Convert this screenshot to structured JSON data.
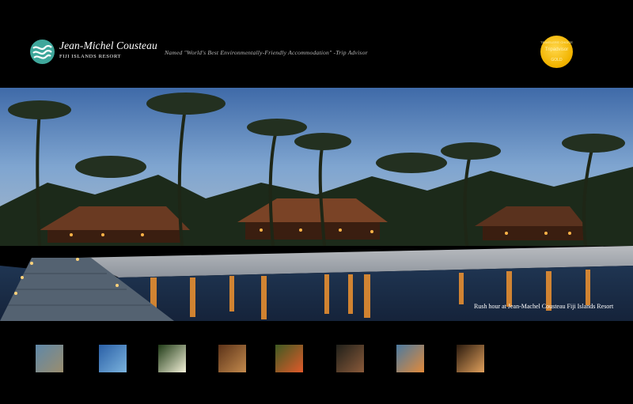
{
  "header": {
    "logo": {
      "name": "Jean-Michel Cousteau",
      "subtitle": "FIJI ISLANDS RESORT"
    },
    "tagline": "Named \"World's Best Environmentally-Friendly Accommodation\" -Trip Advisor",
    "award": {
      "top": "TRAVELERS' CHOICE",
      "main": "Tripadvisor",
      "bottom": "GOLD"
    }
  },
  "hero": {
    "caption": "Rush hour at Jean-Machel Cousteau Fiji Islands Resort"
  },
  "thumbnails": [
    {
      "name": "aerial-reef",
      "colors": [
        "#5f88a8",
        "#9a8d6e"
      ]
    },
    {
      "name": "dolphin",
      "colors": [
        "#2a5fa6",
        "#7bb3dd"
      ]
    },
    {
      "name": "frangipani-flowers",
      "colors": [
        "#1f3a16",
        "#f3f1d8"
      ]
    },
    {
      "name": "bure-interior",
      "colors": [
        "#5b3218",
        "#c38a4d"
      ]
    },
    {
      "name": "tropical-fruit",
      "colors": [
        "#3e5a22",
        "#e15a2a"
      ]
    },
    {
      "name": "smiling-child",
      "colors": [
        "#20201a",
        "#8a5a3a"
      ]
    },
    {
      "name": "beach-sunset",
      "colors": [
        "#4b7aa0",
        "#e28a3a"
      ]
    },
    {
      "name": "nautilus-shell",
      "colors": [
        "#2a1a0e",
        "#e0a05c"
      ]
    }
  ]
}
